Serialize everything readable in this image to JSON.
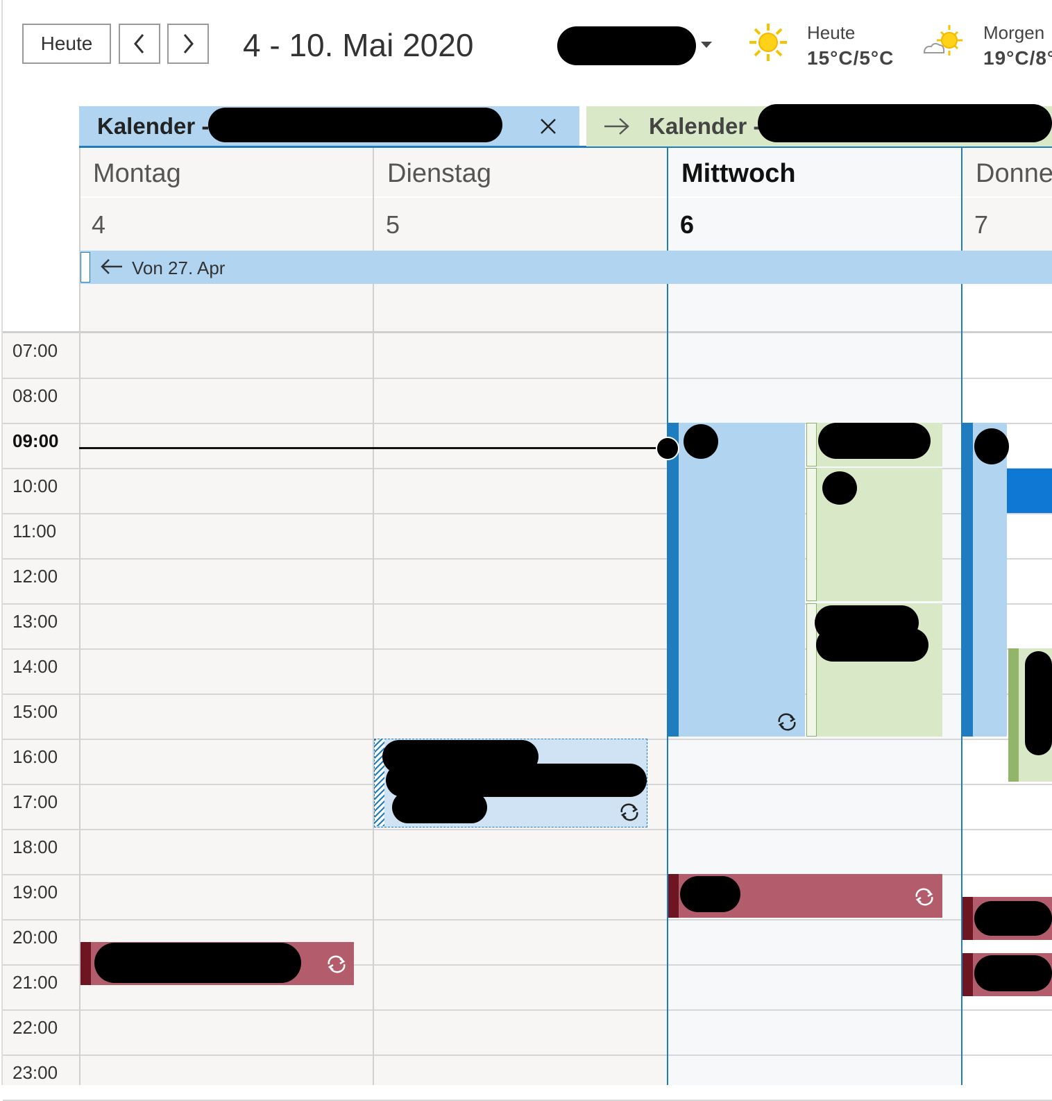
{
  "toolbar": {
    "today_button": "Heute",
    "prev_icon": "chevron-left-icon",
    "next_icon": "chevron-right-icon",
    "date_range": "4 - 10. Mai 2020"
  },
  "weather": {
    "today": {
      "label": "Heute",
      "temp": "15°C/5°C",
      "icon": "sun-icon"
    },
    "tomorrow": {
      "label": "Morgen",
      "temp": "19°C/8°",
      "icon": "partly-cloudy-icon"
    }
  },
  "calendars": [
    {
      "label": "Kalender -",
      "color": "#b1d5f1"
    },
    {
      "label": "Kalender -",
      "color": "#d9e9c8"
    }
  ],
  "days": [
    {
      "name": "Montag",
      "number": "4"
    },
    {
      "name": "Dienstag",
      "number": "5"
    },
    {
      "name": "Mittwoch",
      "number": "6"
    },
    {
      "name": "Donne",
      "number": "7"
    }
  ],
  "allday_banner": "Von 27. Apr",
  "hours": [
    "07:00",
    "08:00",
    "09:00",
    "10:00",
    "11:00",
    "12:00",
    "13:00",
    "14:00",
    "15:00",
    "16:00",
    "17:00",
    "18:00",
    "19:00",
    "20:00",
    "21:00",
    "22:00",
    "23:00"
  ],
  "current_hour": "09:00",
  "colors": {
    "accent_blue": "#1f7dbf",
    "event_blue": "#b1d5f1",
    "event_green": "#d9e9c8",
    "event_red": "#b35d6c",
    "event_red_bar": "#6e1522"
  },
  "icons": {
    "close": "close-icon",
    "arrow_right": "arrow-right-icon",
    "arrow_left": "arrow-left-icon",
    "recurring": "recurring-icon"
  }
}
